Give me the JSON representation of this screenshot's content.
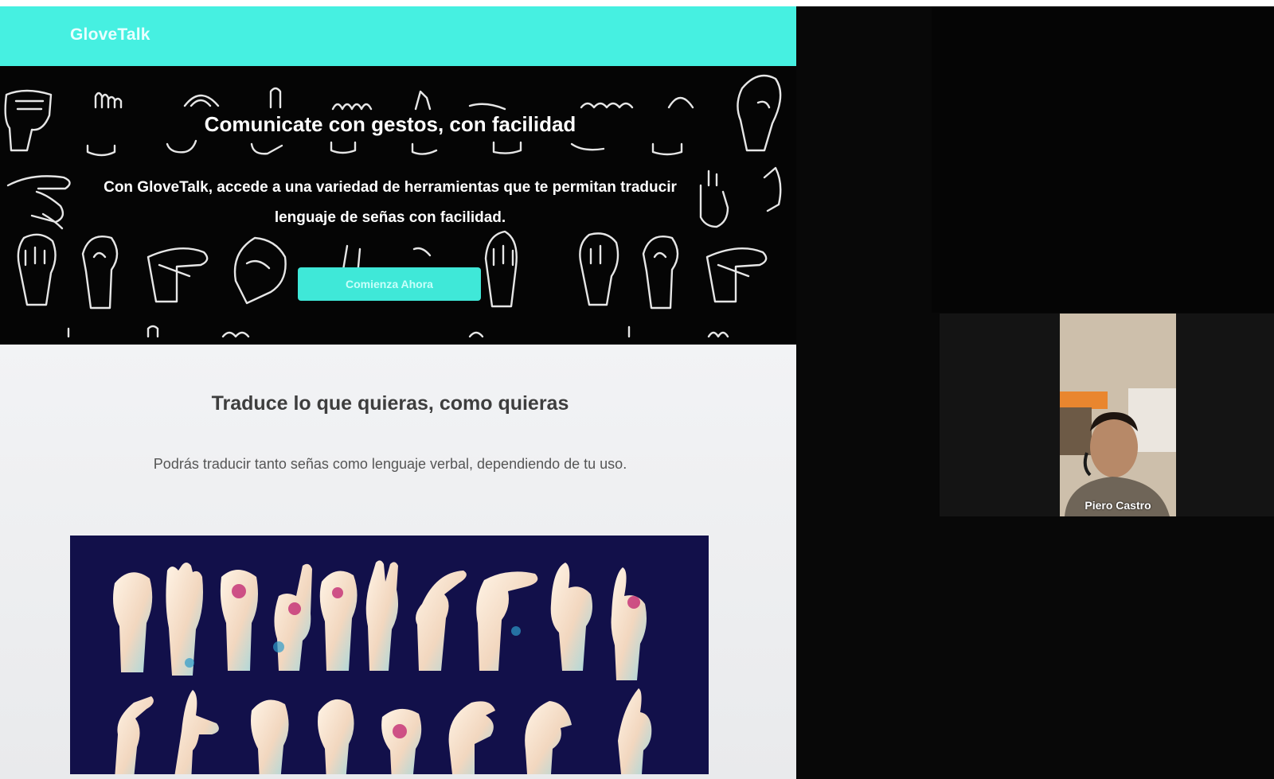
{
  "app": {
    "brand": "GloveTalk",
    "hero": {
      "title": "Comunicate con gestos, con facilidad",
      "subtitle": "Con GloveTalk, accede a una variedad de herramientas que te permitan traducir lenguaje de señas con facilidad.",
      "cta_label": "Comienza Ahora"
    },
    "section": {
      "title": "Traduce lo que quieras, como quieras",
      "description": "Podrás traducir tanto señas como lenguaje verbal, dependiendo de tu uso."
    }
  },
  "meeting": {
    "participant_name": "Piero Castro"
  },
  "colors": {
    "nav": "#46f0e1",
    "cta": "#3fe8d8",
    "hero_bg": "#050505",
    "image_bg": "#12104a"
  },
  "icons": [
    "hand-sign-doodle",
    "hand-sign-illustration"
  ]
}
